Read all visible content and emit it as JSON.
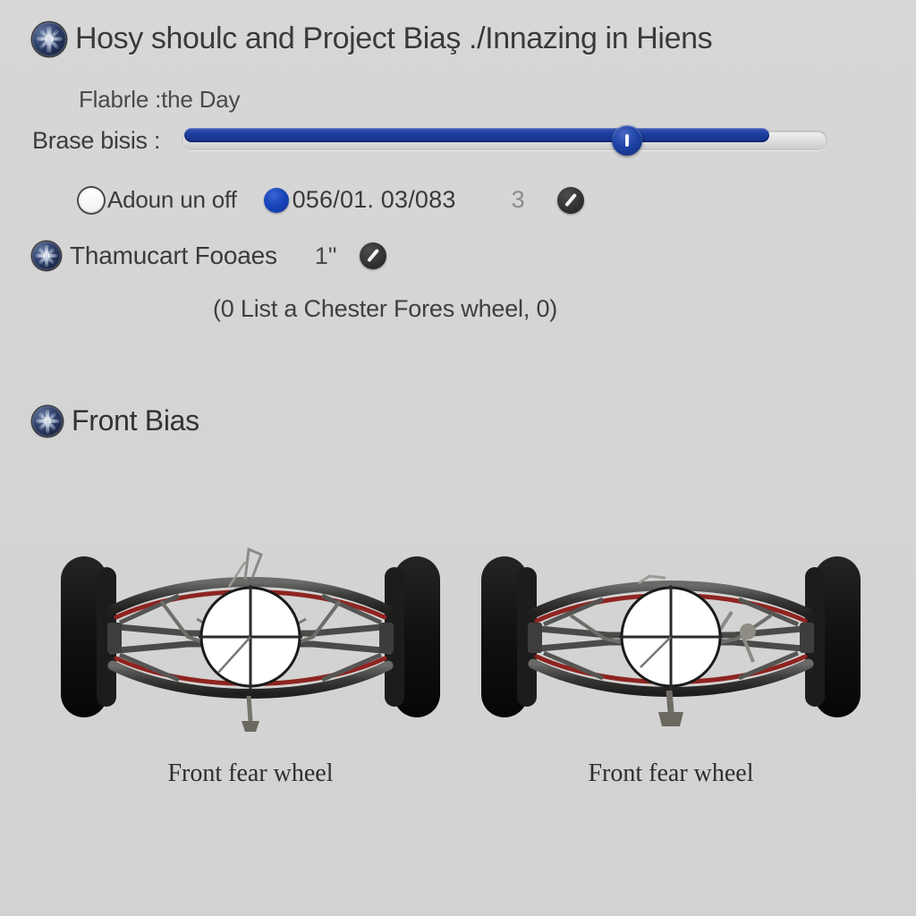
{
  "page": {
    "background_color": "#d6d6d6",
    "accent_blue": "#1c3f9e",
    "text_color": "#3a3a3a"
  },
  "title": {
    "icon": "wheel-icon",
    "text": "Hosy shoulc and Project Biaş ./Innazing in Hiens"
  },
  "flabrle": {
    "label": "Flabrle :",
    "value": "the Day"
  },
  "slider": {
    "label": "Brase bisis :",
    "fill_percent": 90.5,
    "thumb_percent": 69
  },
  "options": {
    "radio_off_label": "Adoun un off",
    "radio_off_state": "unselected",
    "radio_on_state": "selected",
    "value_text": "056/01. 03/083",
    "count_text": "3",
    "edit_icon": "slash-circle-icon"
  },
  "thamucart": {
    "icon": "wheel-icon",
    "label": "Thamucart Fooaes",
    "unit": "1\"",
    "edit_icon": "slash-circle-icon"
  },
  "note": {
    "text": "(0 List a Chester Fores wheel, 0)"
  },
  "front_bias": {
    "icon": "wheel-icon",
    "heading": "Front Bias"
  },
  "figures": [
    {
      "name": "front-suspension-assembly-left",
      "caption": "Front fear wheel"
    },
    {
      "name": "front-suspension-assembly-right",
      "caption": "Front fear wheel"
    }
  ]
}
